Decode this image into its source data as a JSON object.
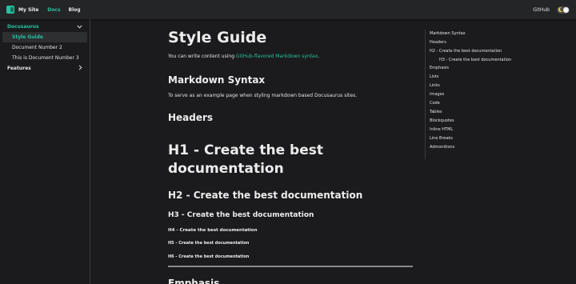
{
  "navbar": {
    "brand": "My Site",
    "links": [
      "Docs",
      "Blog"
    ],
    "github": "GitHub"
  },
  "sidebar": {
    "categories": [
      {
        "label": "Docusaurus",
        "items": [
          "Style Guide",
          "Document Number 2",
          "This is Document Number 3"
        ]
      },
      {
        "label": "Features"
      }
    ]
  },
  "main": {
    "title": "Style Guide",
    "intro_prefix": "You can write content using ",
    "intro_link": "GitHub-flavored Markdown syntax",
    "intro_suffix": ".",
    "markdown_heading": "Markdown Syntax",
    "markdown_desc": "To serve as an example page when styling markdown based Docusaurus sites.",
    "headers_heading": "Headers",
    "h1": "H1 - Create the best documentation",
    "h2": "H2 - Create the best documentation",
    "h3": "H3 - Create the best documentation",
    "h4": "H4 - Create the best documentation",
    "h5": "H5 - Create the best documentation",
    "h6": "H6 - Create the best documentation",
    "next_heading": "Emphasis"
  },
  "toc": {
    "items": [
      "Markdown Syntax",
      "Headers",
      "H2 - Create the best documentation",
      "H3 - Create the best documentation",
      "Emphasis",
      "Lists",
      "Links",
      "Images",
      "Code",
      "Tables",
      "Blockquotes",
      "Inline HTML",
      "Line Breaks",
      "Admonitions"
    ]
  },
  "colors": {
    "accent": "#25c2a0",
    "background": "#1b1b1d",
    "navbar": "#242526"
  }
}
